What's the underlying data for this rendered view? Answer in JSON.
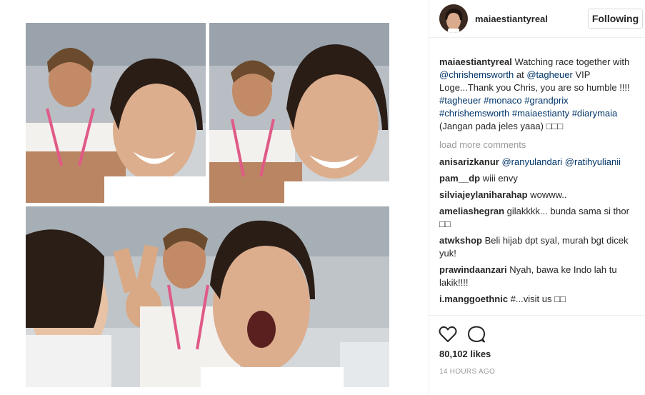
{
  "post": {
    "author": "maiaestiantyreal",
    "follow_label": "Following",
    "caption": {
      "username": "maiaestiantyreal",
      "text_1": " Watching race together with ",
      "mention_1": "@chrishemsworth",
      "text_2": " at ",
      "mention_2": "@tagheuer",
      "text_3": " VIP Loge...Thank you Chris, you are so humble !!!!",
      "hashtags": "#tagheuer #monaco #grandprix #chrishemsworth #maiaestianty #diarymaia",
      "tail": "(Jangan pada jeles yaaa) □□□"
    },
    "load_more": "load more comments",
    "comments": [
      {
        "user": "anisarizkanur",
        "text": "",
        "mentions": "@ranyulandari @ratihyulianii"
      },
      {
        "user": "pam__dp",
        "text": "wiii envy",
        "mentions": ""
      },
      {
        "user": "silviajeylaniharahap",
        "text": "wowww..",
        "mentions": ""
      },
      {
        "user": "ameliashegran",
        "text": "gilakkkk... bunda sama si thor □□",
        "mentions": ""
      },
      {
        "user": "atwkshop",
        "text": "Beli hijab dpt syal, murah bgt dicek yuk!",
        "mentions": ""
      },
      {
        "user": "prawindaanzari",
        "text": "Nyah, bawa ke Indo lah tu lakik!!!!",
        "mentions": ""
      },
      {
        "user": "i.manggoethnic",
        "text": "#...visit us □□",
        "mentions": ""
      }
    ],
    "likes": "80,102 likes",
    "time": "14 HOURS AGO",
    "icons": {
      "like": "heart-icon",
      "comment": "comment-bubble-icon"
    }
  }
}
